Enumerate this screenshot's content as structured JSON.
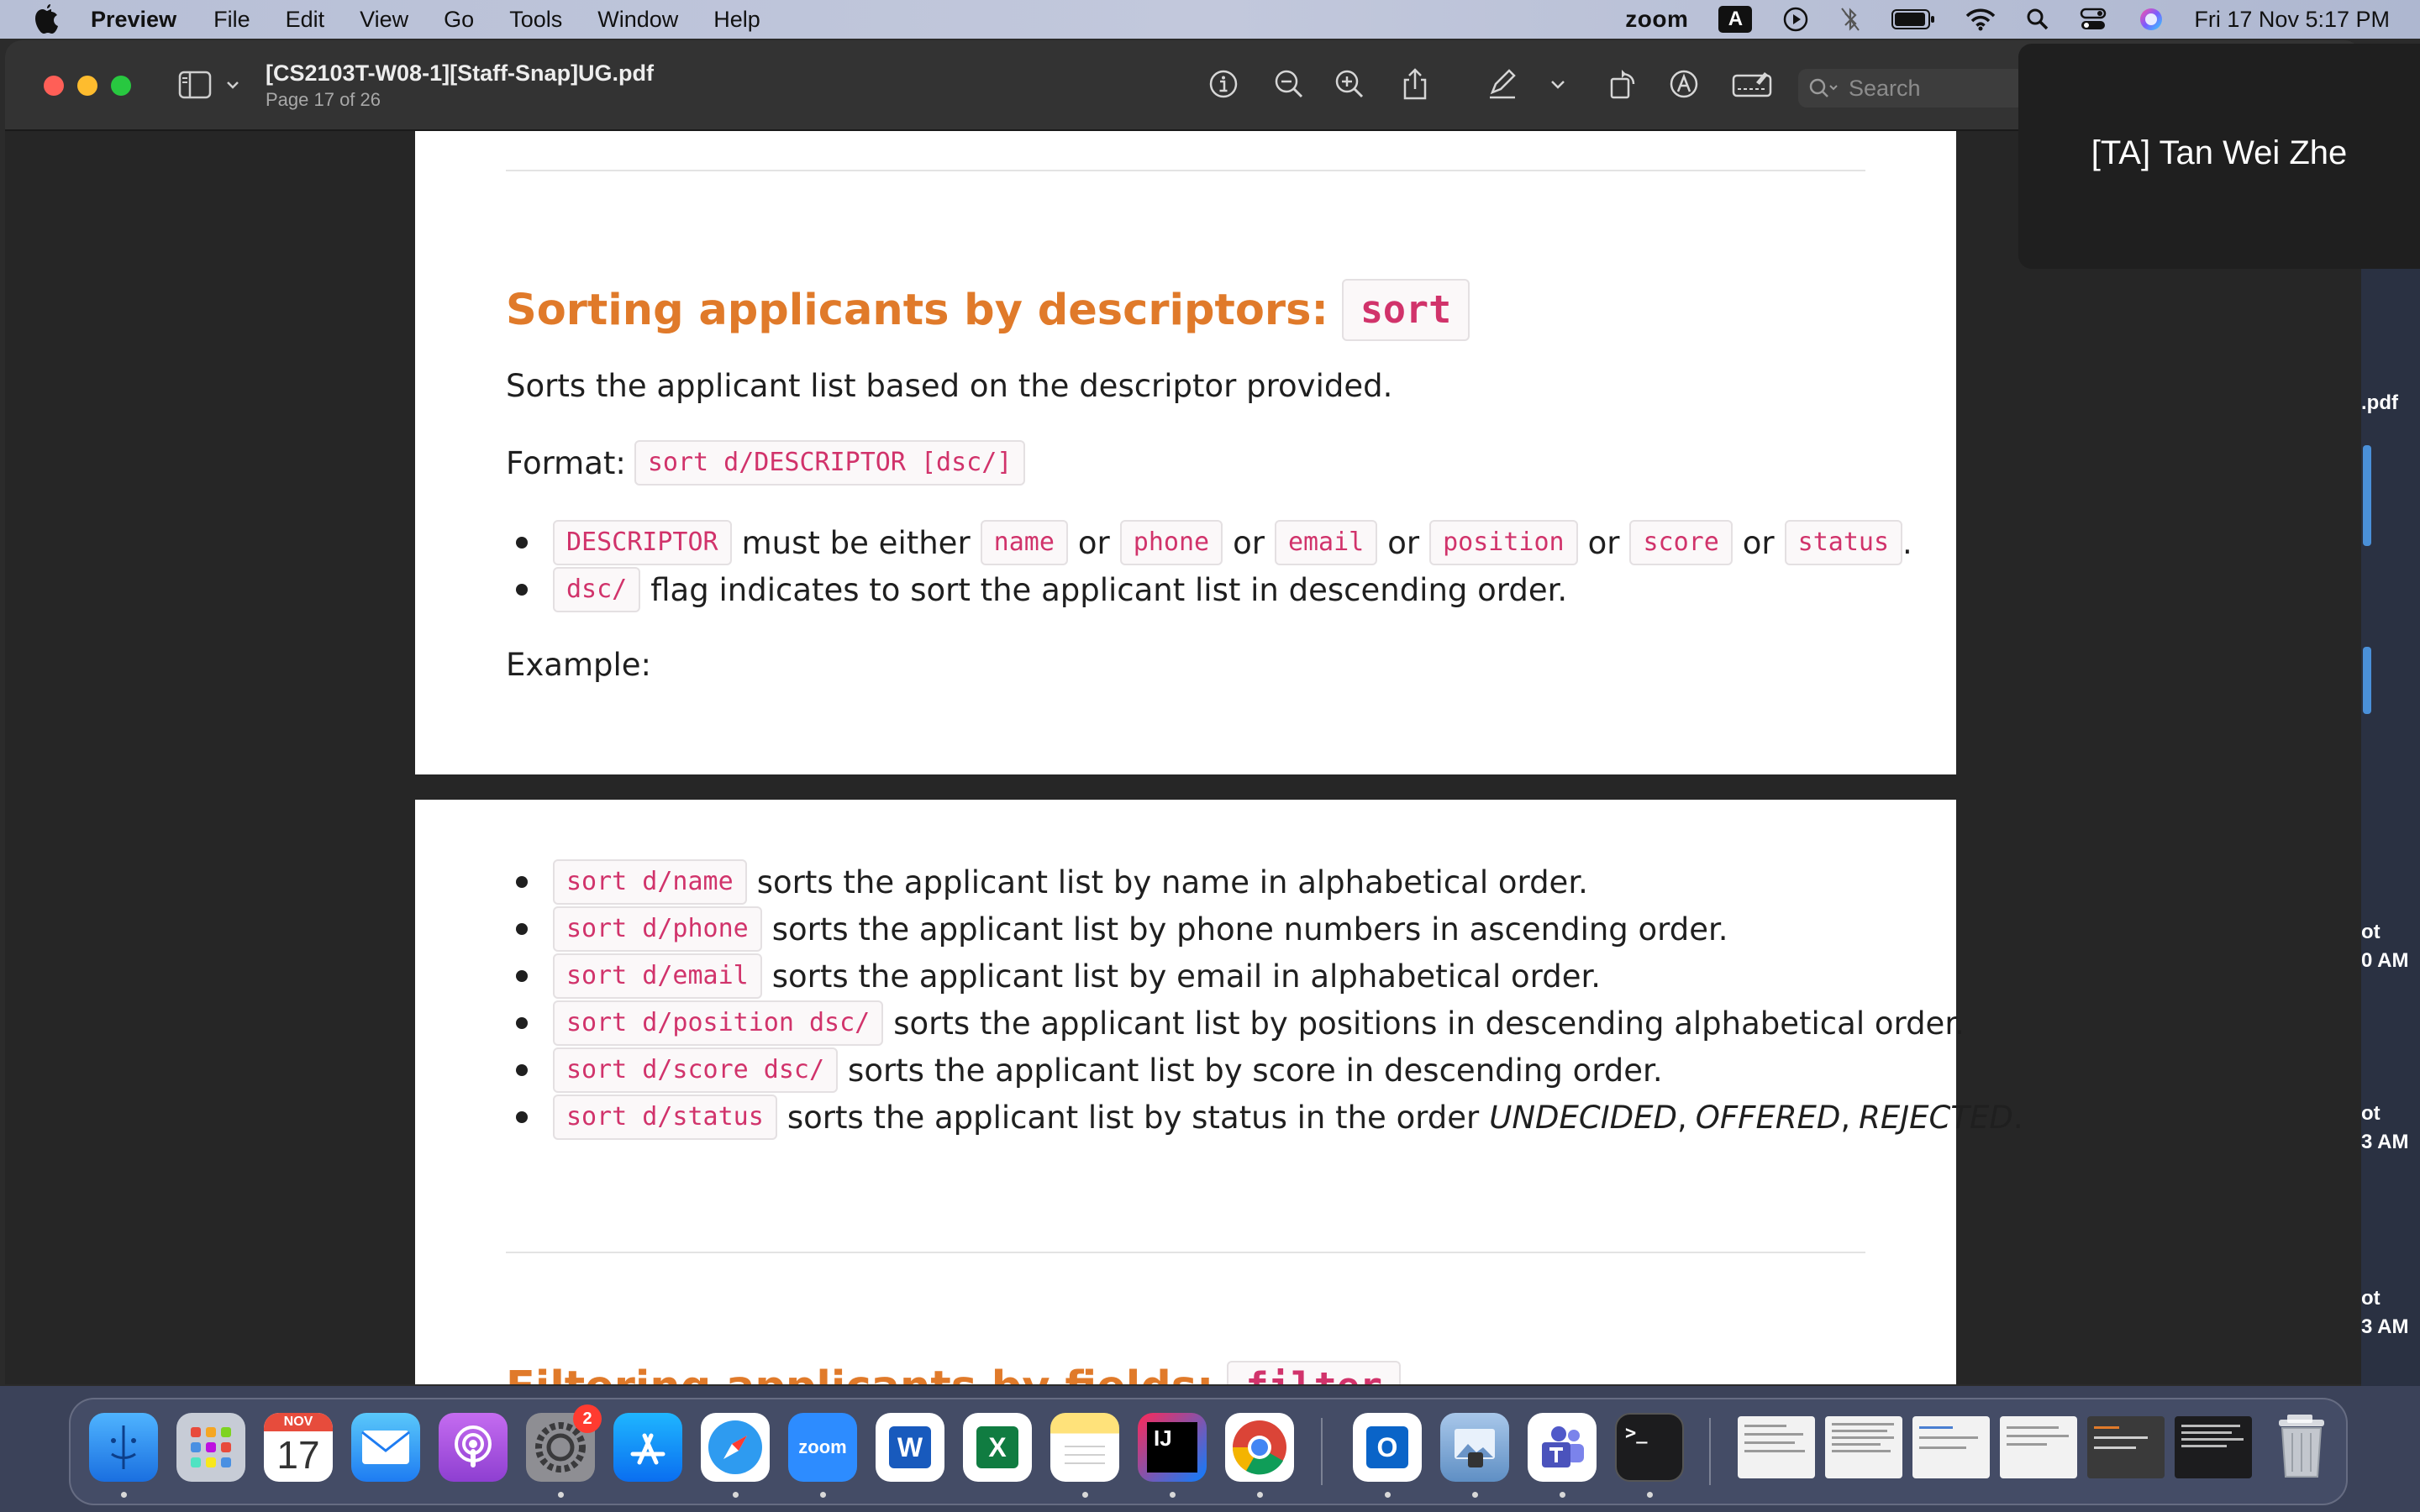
{
  "menubar": {
    "app_name": "Preview",
    "items": [
      "File",
      "Edit",
      "View",
      "Go",
      "Tools",
      "Window",
      "Help"
    ],
    "status": {
      "zoom_label": "zoom",
      "input_source": "A",
      "datetime": "Fri 17 Nov  5:17 PM"
    }
  },
  "window": {
    "title": "[CS2103T-W08-1][Staff-Snap]UG.pdf",
    "subtitle": "Page 17 of 26",
    "search_placeholder": "Search",
    "toolbar_icons": [
      "info-icon",
      "zoom-out-icon",
      "zoom-in-icon",
      "share-icon",
      "highlight-pen-icon",
      "chevron-down-icon",
      "rotate-icon",
      "markup-icon",
      "signature-icon"
    ]
  },
  "document": {
    "heading": "Sorting applicants by descriptors:",
    "heading_code": "sort",
    "description": "Sorts the applicant list based on the descriptor provided.",
    "format_label": "Format:",
    "format_code": "sort d/DESCRIPTOR [dsc/]",
    "rule1": {
      "code": "DESCRIPTOR",
      "text": "must be either",
      "options": [
        "name",
        "phone",
        "email",
        "position",
        "score",
        "status"
      ],
      "connector": "or",
      "end": "."
    },
    "rule2": {
      "code": "dsc/",
      "text": "flag indicates to sort the applicant list in descending order."
    },
    "example_label": "Example:",
    "examples": [
      {
        "code": "sort d/name",
        "text": "sorts the applicant list by name in alphabetical order."
      },
      {
        "code": "sort d/phone",
        "text": "sorts the applicant list by phone numbers in ascending order."
      },
      {
        "code": "sort d/email",
        "text": "sorts the applicant list by email in alphabetical order."
      },
      {
        "code": "sort d/position dsc/",
        "text": "sorts the applicant list by positions in descending alphabetical order."
      },
      {
        "code": "sort d/score dsc/",
        "text": "sorts the applicant list by score in descending order."
      }
    ],
    "status_example": {
      "code": "sort d/status",
      "text": "sorts the applicant list by status in the order",
      "statuses": [
        "UNDECIDED",
        "OFFERED",
        "REJECTED"
      ],
      "sep": ",",
      "end": "."
    },
    "next_heading": "Filtering applicants by fields:",
    "next_heading_code": "filter"
  },
  "zoom": {
    "participant": "[TA] Tan Wei Zhe"
  },
  "desktop": {
    "labels": [
      ".pdf",
      "ot",
      "0 AM",
      "ot",
      "3 AM",
      "ot",
      "3 AM"
    ]
  },
  "dock": {
    "calendar_month": "NOV",
    "calendar_day": "17",
    "settings_badge": "2",
    "zoom_label": "zoom",
    "word_label": "W",
    "excel_label": "X",
    "intellij_label": "IJ",
    "outlook_label": "O",
    "terminal_label": ">_",
    "apps": [
      "finder-icon",
      "launchpad-icon",
      "calendar-icon",
      "mail-icon",
      "podcasts-icon",
      "system-settings-icon",
      "app-store-icon",
      "safari-icon",
      "zoom-icon",
      "word-icon",
      "excel-icon",
      "notes-icon",
      "intellij-icon",
      "chrome-icon",
      "outlook-icon",
      "preview-icon",
      "teams-icon",
      "terminal-icon",
      "trash-icon"
    ]
  },
  "colors": {
    "heading": "#e07a2a",
    "code_text": "#d1336b",
    "menubar": "#b7bfd6"
  }
}
